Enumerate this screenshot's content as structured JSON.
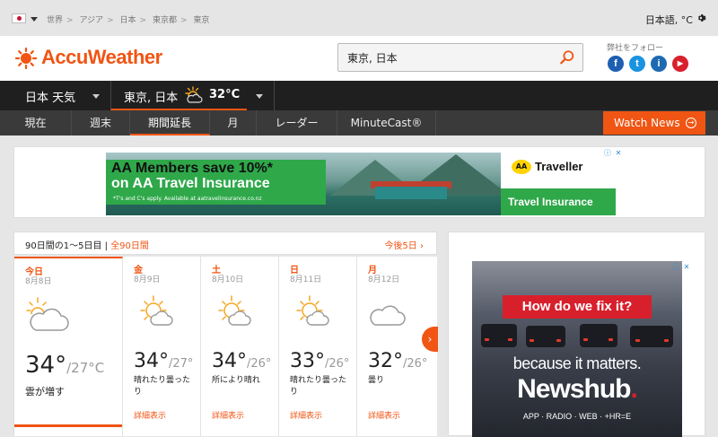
{
  "breadcrumb": [
    "世界",
    "アジア",
    "日本",
    "東京都",
    "東京"
  ],
  "language": "日本語, °C",
  "brand": {
    "name": "AccuWeather",
    "color": "#f05514"
  },
  "search": {
    "value": "東京, 日本"
  },
  "follow_label": "弊社をフォロー",
  "social": [
    "f",
    "t",
    "i",
    "▶"
  ],
  "location_bar": {
    "country": "日本 天気",
    "city": "東京, 日本",
    "temp": "32°C"
  },
  "nav": {
    "items": [
      "現在",
      "週末",
      "期間延長",
      "月",
      "レーダー",
      "MinuteCast®"
    ],
    "active": "期間延長",
    "watch_news": "Watch News"
  },
  "ad_banner": {
    "line1": "AA Members save 10%*",
    "line2": "on AA Travel Insurance",
    "fine": "*T's and C's apply. Available at aatravelinsurance.co.nz",
    "brand": "AA",
    "brand_name": "Traveller",
    "cta": "Travel Insurance"
  },
  "forecast": {
    "title": "90日間の1〜5日目 | ",
    "title_link": "全90日間",
    "next_link": "今後5日",
    "days": [
      {
        "day": "今日",
        "date": "8月8日",
        "icon": "partly-cloudy-icon",
        "hi": "34°",
        "lo": "/27°C",
        "desc": "雲が増す",
        "more": ""
      },
      {
        "day": "金",
        "date": "8月9日",
        "icon": "sun-cloud-icon",
        "hi": "34°",
        "lo": "/27°",
        "desc": "晴れたり曇ったり",
        "more": "詳細表示"
      },
      {
        "day": "土",
        "date": "8月10日",
        "icon": "sun-cloud-icon",
        "hi": "34°",
        "lo": "/26°",
        "desc": "所により晴れ",
        "more": "詳細表示"
      },
      {
        "day": "日",
        "date": "8月11日",
        "icon": "sun-cloud-icon",
        "hi": "33°",
        "lo": "/26°",
        "desc": "晴れたり曇ったり",
        "more": "詳細表示"
      },
      {
        "day": "月",
        "date": "8月12日",
        "icon": "cloud-icon",
        "hi": "32°",
        "lo": "/26°",
        "desc": "曇り",
        "more": "詳細表示"
      }
    ]
  },
  "side_ad": {
    "question": "How do we fix it?",
    "tagline": "because it matters.",
    "brand": "Newshub",
    "brand_dot": ".",
    "sub": "APP · RADIO · WEB · +HR=E"
  }
}
